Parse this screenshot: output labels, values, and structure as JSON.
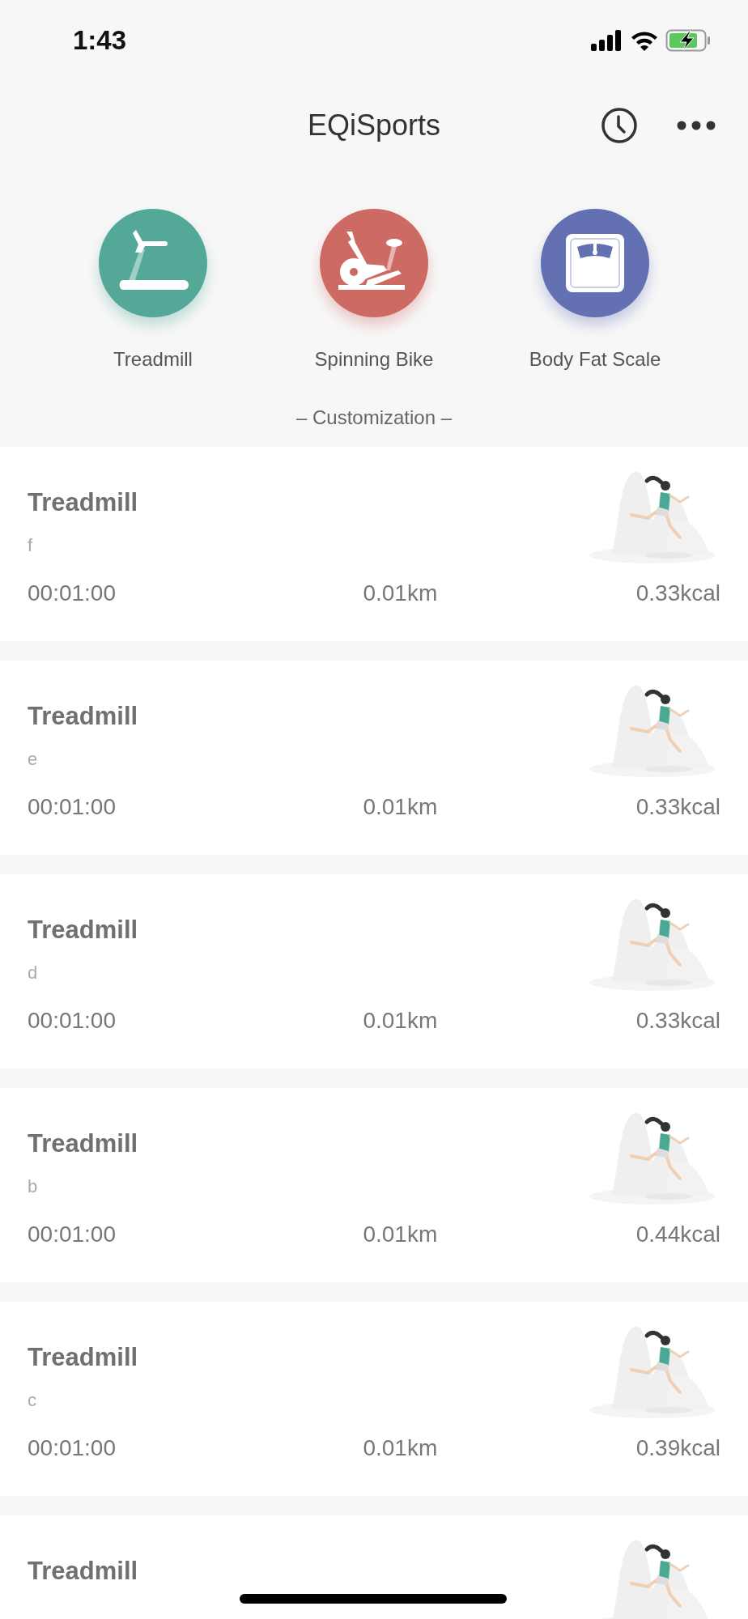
{
  "status_bar": {
    "time": "1:43"
  },
  "header": {
    "title": "EQiSports"
  },
  "devices": [
    {
      "kind": "treadmill",
      "label": "Treadmill",
      "color": "#53a898"
    },
    {
      "kind": "bike",
      "label": "Spinning Bike",
      "color": "#cd6a63"
    },
    {
      "kind": "scale",
      "label": "Body Fat Scale",
      "color": "#6371b3"
    }
  ],
  "section_label": "– Customization –",
  "records": [
    {
      "title": "Treadmill",
      "subtitle": "f",
      "duration": "00:01:00",
      "distance": "0.01km",
      "calories": "0.33kcal"
    },
    {
      "title": "Treadmill",
      "subtitle": "e",
      "duration": "00:01:00",
      "distance": "0.01km",
      "calories": "0.33kcal"
    },
    {
      "title": "Treadmill",
      "subtitle": "d",
      "duration": "00:01:00",
      "distance": "0.01km",
      "calories": "0.33kcal"
    },
    {
      "title": "Treadmill",
      "subtitle": "b",
      "duration": "00:01:00",
      "distance": "0.01km",
      "calories": "0.44kcal"
    },
    {
      "title": "Treadmill",
      "subtitle": "c",
      "duration": "00:01:00",
      "distance": "0.01km",
      "calories": "0.39kcal"
    },
    {
      "title": "Treadmill"
    }
  ]
}
